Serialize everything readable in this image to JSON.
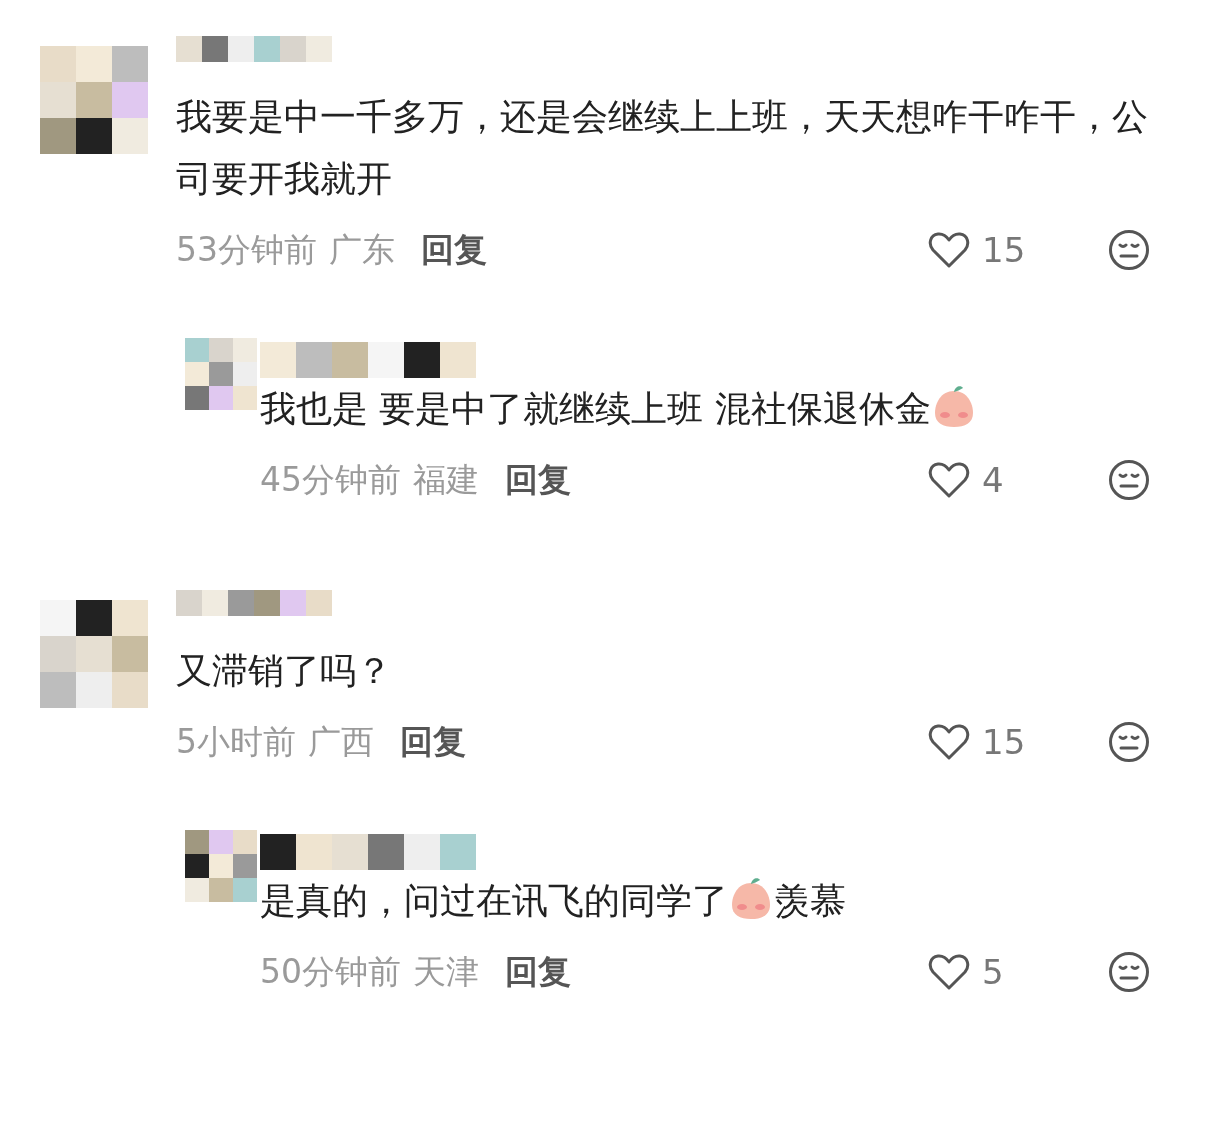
{
  "comments": [
    {
      "content": [
        {
          "kind": "text",
          "value": "我要是中一千多万，还是会继续上上班，天天想咋干咋干，公司要开我就开"
        }
      ],
      "time": "53分钟前",
      "location": "广东",
      "reply_label": "回复",
      "likes": "15",
      "children": [
        {
          "content": [
            {
              "kind": "text",
              "value": "我也是 要是中了就继续上班 混社保退休金"
            },
            {
              "kind": "sticker"
            }
          ],
          "time": "45分钟前",
          "location": "福建",
          "reply_label": "回复",
          "likes": "4"
        }
      ]
    },
    {
      "content": [
        {
          "kind": "text",
          "value": "又滞销了吗？"
        }
      ],
      "time": "5小时前",
      "location": "广西",
      "reply_label": "回复",
      "likes": "15",
      "children": [
        {
          "content": [
            {
              "kind": "text",
              "value": "是真的，问过在讯飞的同学了"
            },
            {
              "kind": "sticker"
            },
            {
              "kind": "text",
              "value": "羡慕"
            }
          ],
          "time": "50分钟前",
          "location": "天津",
          "reply_label": "回复",
          "likes": "5"
        }
      ]
    }
  ]
}
